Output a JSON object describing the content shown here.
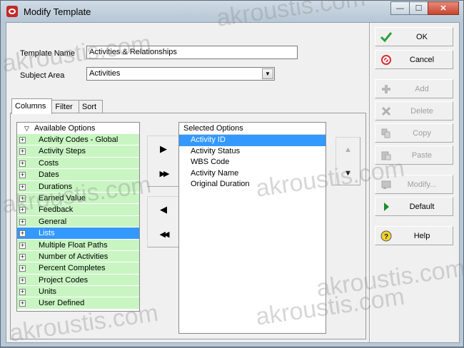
{
  "window": {
    "title": "Modify Template",
    "min_glyph": "—",
    "max_glyph": "☐",
    "close_glyph": "✕"
  },
  "form": {
    "template_name_label": "Template Name",
    "template_name_value": "Activities & Relationships",
    "subject_area_label": "Subject Area",
    "subject_area_value": "Activities",
    "dropdown_glyph": "▼"
  },
  "tabs": [
    {
      "label": "Columns",
      "active": true
    },
    {
      "label": "Filter",
      "active": false
    },
    {
      "label": "Sort",
      "active": false
    }
  ],
  "available": {
    "header": "Available Options",
    "header_glyph": "▽",
    "items": [
      {
        "label": "Activity Codes - Global",
        "selected": false
      },
      {
        "label": "Activity Steps",
        "selected": false
      },
      {
        "label": "Costs",
        "selected": false
      },
      {
        "label": "Dates",
        "selected": false
      },
      {
        "label": "Durations",
        "selected": false
      },
      {
        "label": "Earned Value",
        "selected": false
      },
      {
        "label": "Feedback",
        "selected": false
      },
      {
        "label": "General",
        "selected": false
      },
      {
        "label": "Lists",
        "selected": true
      },
      {
        "label": "Multiple Float Paths",
        "selected": false
      },
      {
        "label": "Number of Activities",
        "selected": false
      },
      {
        "label": "Percent Completes",
        "selected": false
      },
      {
        "label": "Project Codes",
        "selected": false
      },
      {
        "label": "Units",
        "selected": false
      },
      {
        "label": "User Defined",
        "selected": false
      }
    ],
    "expand_glyph": "+"
  },
  "transfer": {
    "add_one": "▶",
    "add_all": "▶▶",
    "remove_one": "◀",
    "remove_all": "◀◀"
  },
  "selected": {
    "header": "Selected Options",
    "items": [
      {
        "label": "Activity ID",
        "selected": true
      },
      {
        "label": "Activity Status",
        "selected": false
      },
      {
        "label": "WBS Code",
        "selected": false
      },
      {
        "label": "Activity Name",
        "selected": false
      },
      {
        "label": "Original Duration",
        "selected": false
      }
    ]
  },
  "order": {
    "up": "▲",
    "down": "▼"
  },
  "actions": {
    "ok": "OK",
    "cancel": "Cancel",
    "add": "Add",
    "delete": "Delete",
    "copy": "Copy",
    "paste": "Paste",
    "modify": "Modify...",
    "default": "Default",
    "help": "Help"
  },
  "colors": {
    "list_highlight": "#3399ff",
    "available_row_bg": "#c8f5c2",
    "ok_check": "#2e9e3a",
    "cancel_red": "#d32f2f",
    "default_arrow": "#1e8c2e",
    "help_yellow": "#f1d22f"
  },
  "watermark_text": "akroustis.com"
}
